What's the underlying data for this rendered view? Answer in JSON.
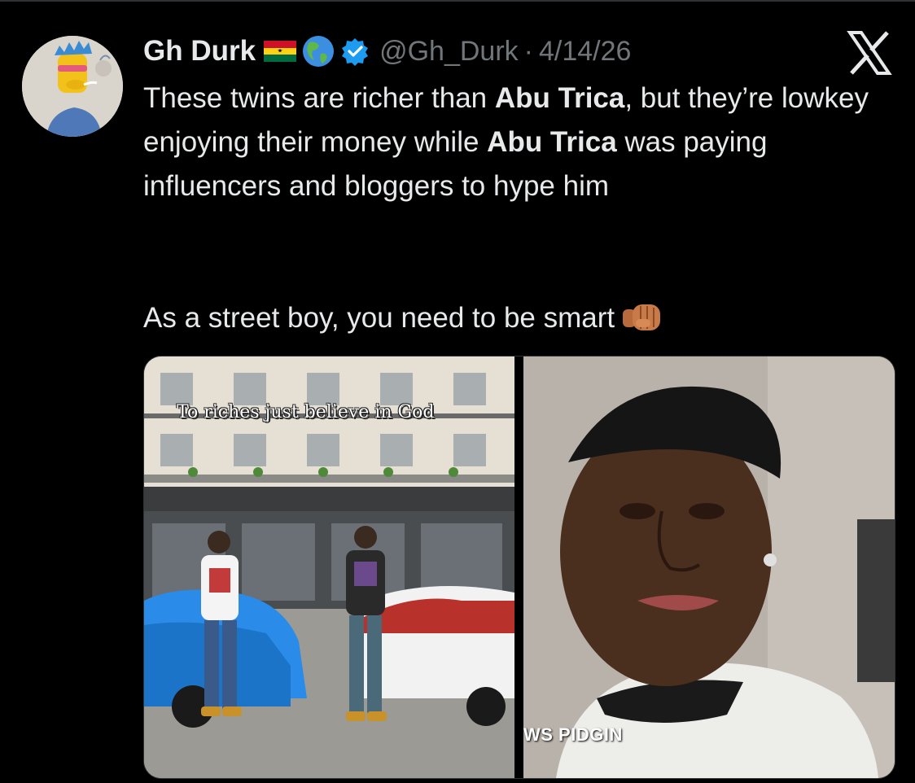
{
  "author": {
    "display_name": "Gh Durk",
    "handle": "@Gh_Durk",
    "separator": "·",
    "date": "4/14/26",
    "badges": [
      "ghana-flag-icon",
      "globe-americas-icon",
      "verified-badge-icon"
    ]
  },
  "tweet": {
    "p1_a": "These twins are richer than ",
    "p1_b": "Abu Trica",
    "p1_c": ", but they’re lowkey enjoying their money while ",
    "p1_d": "Abu Trica",
    "p1_e": " was paying influencers and bloggers to hype him",
    "p2": "As a street boy, you need to be smart",
    "p2_emoji": "oncoming-fist-icon"
  },
  "media": {
    "left_caption": "To riches just believe in God",
    "right_watermark": "WS PIDGIN"
  },
  "colors": {
    "background": "#000000",
    "text": "#e7e9ea",
    "secondary": "#71767b",
    "verified": "#1d9bf0"
  }
}
